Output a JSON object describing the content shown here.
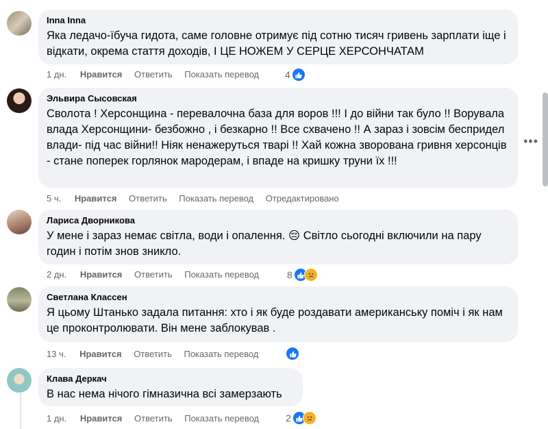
{
  "comments": [
    {
      "author": "Inna Inna",
      "text": "Яка ледачо-їбуча гидота, саме головне отримує під сотню тисяч гривень зарплати іще і відкати, окрема стаття доходів, І ЦЕ НОЖЕМ У СЕРЦЕ ХЕРСОНЧАТАМ",
      "time": "1 дн.",
      "like": "Нравится",
      "reply": "Ответить",
      "translate": "Показать перевод",
      "edited": "",
      "reaction_count": "4",
      "reactions": [
        "like-icon"
      ]
    },
    {
      "author": "Эльвира Сысовская",
      "text": "Сволота ! Херсонщина - перевалочна база для воров !!! І до війни так було !! Ворувала влада Херсонщини- безбожно , і безкарно !! Все схвачено !! А зараз і зовсім беспридел влади- під час війни!! Ніяк ненажеруться тварі !! Хай кожна зворована гривня херсонців - стане поперек горлянок мародерам, і впаде на кришку труни їх !!!",
      "time": "5 ч.",
      "like": "Нравится",
      "reply": "Ответить",
      "translate": "Показать перевод",
      "edited": "Отредактировано",
      "reaction_count": "",
      "reactions": []
    },
    {
      "author": "Лариса Дворникова",
      "text": "У мене і зараз немає світла, води і опалення. 😔 Світло сьогодні включили на пару годин і потім знов зникло.",
      "time": "2 дн.",
      "like": "Нравится",
      "reply": "Ответить",
      "translate": "Показать перевод",
      "edited": "",
      "reaction_count": "8",
      "reactions": [
        "like-icon",
        "sad-icon"
      ]
    },
    {
      "author": "Светлана Классен",
      "text": "Я цьому Штанько задала питання: хто і як буде роздавати американську поміч і як нам це проконтролювати. Він мене заблокував .",
      "time": "13 ч.",
      "like": "Нравится",
      "reply": "Ответить",
      "translate": "Показать перевод",
      "edited": "",
      "reaction_count": "",
      "reactions": [
        "like-icon"
      ]
    },
    {
      "author": "Клава Деркач",
      "text": "В нас нема нічого гімназична всі замерзають",
      "time": "1 дн.",
      "like": "Нравится",
      "reply": "Ответить",
      "translate": "Показать перевод",
      "edited": "",
      "reaction_count": "2",
      "reactions": [
        "like-icon",
        "sad-icon"
      ]
    }
  ],
  "more_icon": "more-horizontal-icon",
  "colors": {
    "bubble": "#f0f2f5",
    "meta": "#65676b",
    "like_blue": "#1877f2",
    "sad_yellow": "#f7b125"
  }
}
